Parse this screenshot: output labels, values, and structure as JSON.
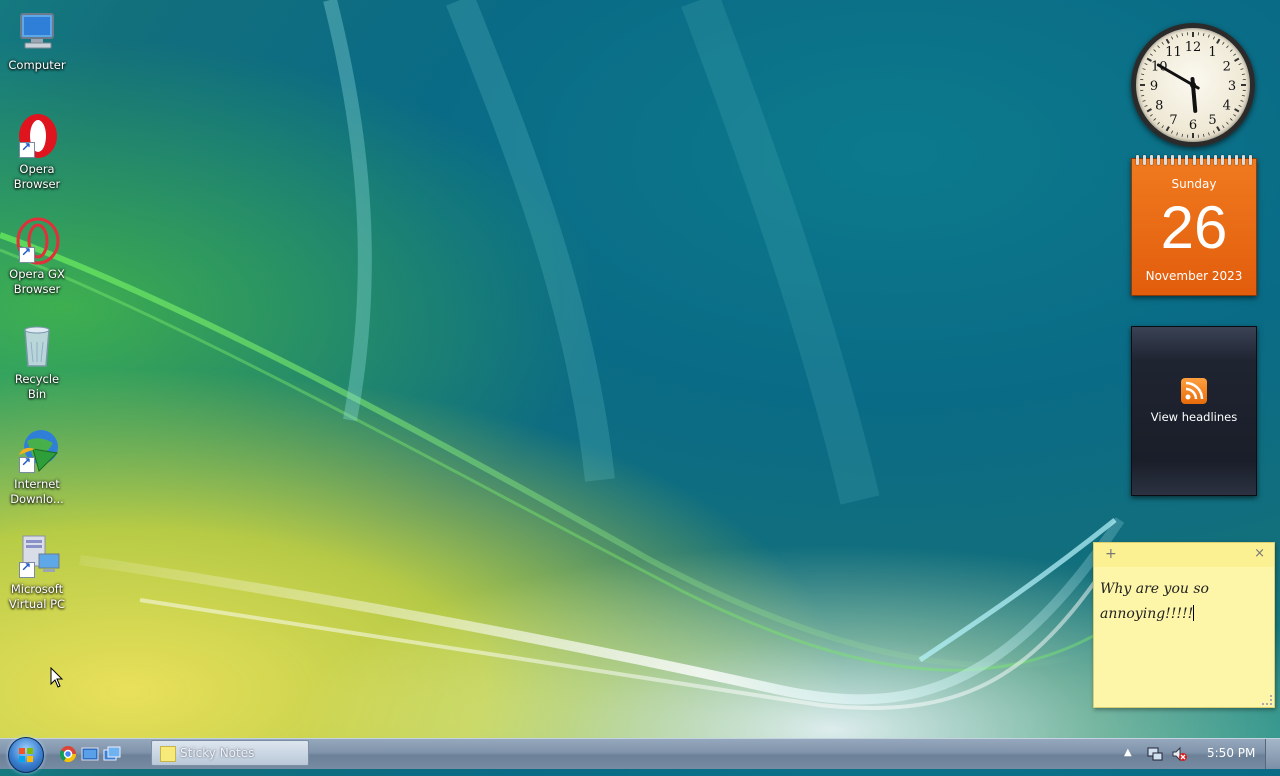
{
  "desktop": {
    "icons": [
      {
        "label": "Computer",
        "icon": "computer-icon"
      },
      {
        "label": "Opera Browser",
        "icon": "opera-icon"
      },
      {
        "label": "Opera GX Browser",
        "icon": "opera-gx-icon"
      },
      {
        "label": "Recycle Bin",
        "icon": "recycle-bin-icon"
      },
      {
        "label": "Internet Downlo...",
        "icon": "internet-download-manager-icon"
      },
      {
        "label": "Microsoft Virtual PC",
        "icon": "virtual-pc-icon"
      }
    ]
  },
  "gadgets": {
    "clock": {
      "hour": 5,
      "minute": 50,
      "numerals": [
        "12",
        "1",
        "2",
        "3",
        "4",
        "5",
        "6",
        "7",
        "8",
        "9",
        "10",
        "11"
      ]
    },
    "calendar": {
      "weekday": "Sunday",
      "day": "26",
      "month_year": "November 2023"
    },
    "feed": {
      "label": "View headlines",
      "icon": "rss-icon"
    }
  },
  "sticky_note": {
    "add_label": "+",
    "close_label": "×",
    "text": "Why are you so annoying!!!!!"
  },
  "taskbar": {
    "start_icon": "windows-start-icon",
    "quick_launch": [
      "chrome-icon",
      "show-desktop-icon",
      "switch-windows-icon"
    ],
    "task_button_label": "Sticky Notes",
    "tray_arrow": "▲",
    "tray_icons": [
      "network-icon",
      "volume-muted-icon"
    ],
    "time": "5:50 PM"
  },
  "colors": {
    "calendar": "#e8650f",
    "sticky": "#fdf6a9",
    "taskbar": "#7f93aa"
  }
}
